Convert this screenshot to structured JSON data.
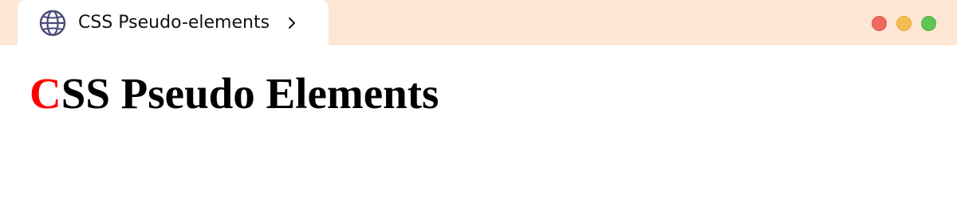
{
  "tab": {
    "title": "CSS Pseudo-elements",
    "icon": "globe-icon",
    "chevron": "chevron-right-icon"
  },
  "window_controls": {
    "close_color": "#ee6a5f",
    "minimize_color": "#f5bd4f",
    "maximize_color": "#61c554"
  },
  "page": {
    "heading_first_letter": "C",
    "heading_rest": "SS Pseudo Elements",
    "first_letter_color": "#ff0000"
  },
  "colors": {
    "titlebar_bg": "#fee6d5",
    "tab_bg": "#ffffff",
    "globe_icon": "#4a4a7a"
  }
}
